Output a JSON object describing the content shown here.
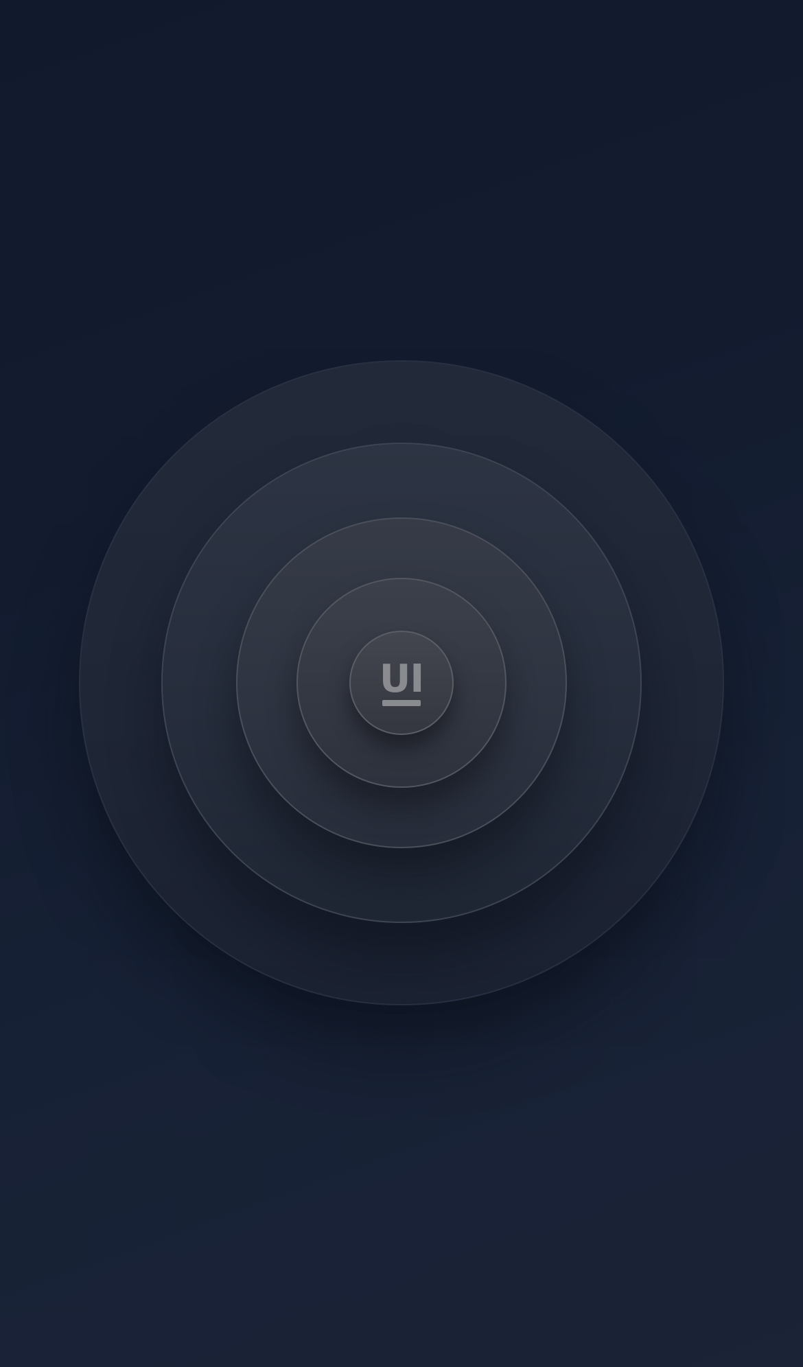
{
  "logo": {
    "text": "UI",
    "icon": "underline-icon",
    "color": "#8a8b8f"
  },
  "colors": {
    "background_top": "#111a2d",
    "background_bottom": "#1b2336"
  }
}
